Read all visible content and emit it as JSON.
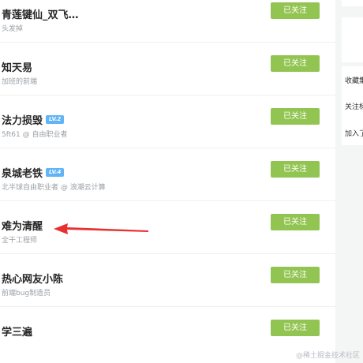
{
  "users": [
    {
      "name": "青莲键仙_双飞…",
      "desc": "头发掉",
      "level": "",
      "button": "已关注"
    },
    {
      "name": "知天易",
      "desc": "加班的前端",
      "level": "",
      "button": "已关注"
    },
    {
      "name": "法力损毁",
      "desc": "5ft61 @ 自由职业者",
      "level": "LV.2",
      "button": "已关注"
    },
    {
      "name": "泉城老铁",
      "desc": "北半球自由职业者 @ 浪潮云计算",
      "level": "LV.4",
      "button": "已关注"
    },
    {
      "name": "难为清醒",
      "desc": "全干工程师",
      "level": "",
      "button": "已关注"
    },
    {
      "name": "热心网友小陈",
      "desc": "前端bug制造员",
      "level": "",
      "button": "已关注"
    },
    {
      "name": "学三遍",
      "desc": "",
      "level": "",
      "button": "已关注"
    }
  ],
  "side_menu": [
    "收藏集",
    "关注标签",
    "加入了"
  ],
  "watermark": "@稀土掘金技术社区",
  "colors": {
    "follow_button": "#92c452",
    "badge": "#61b4f5",
    "arrow": "#e8312f"
  }
}
